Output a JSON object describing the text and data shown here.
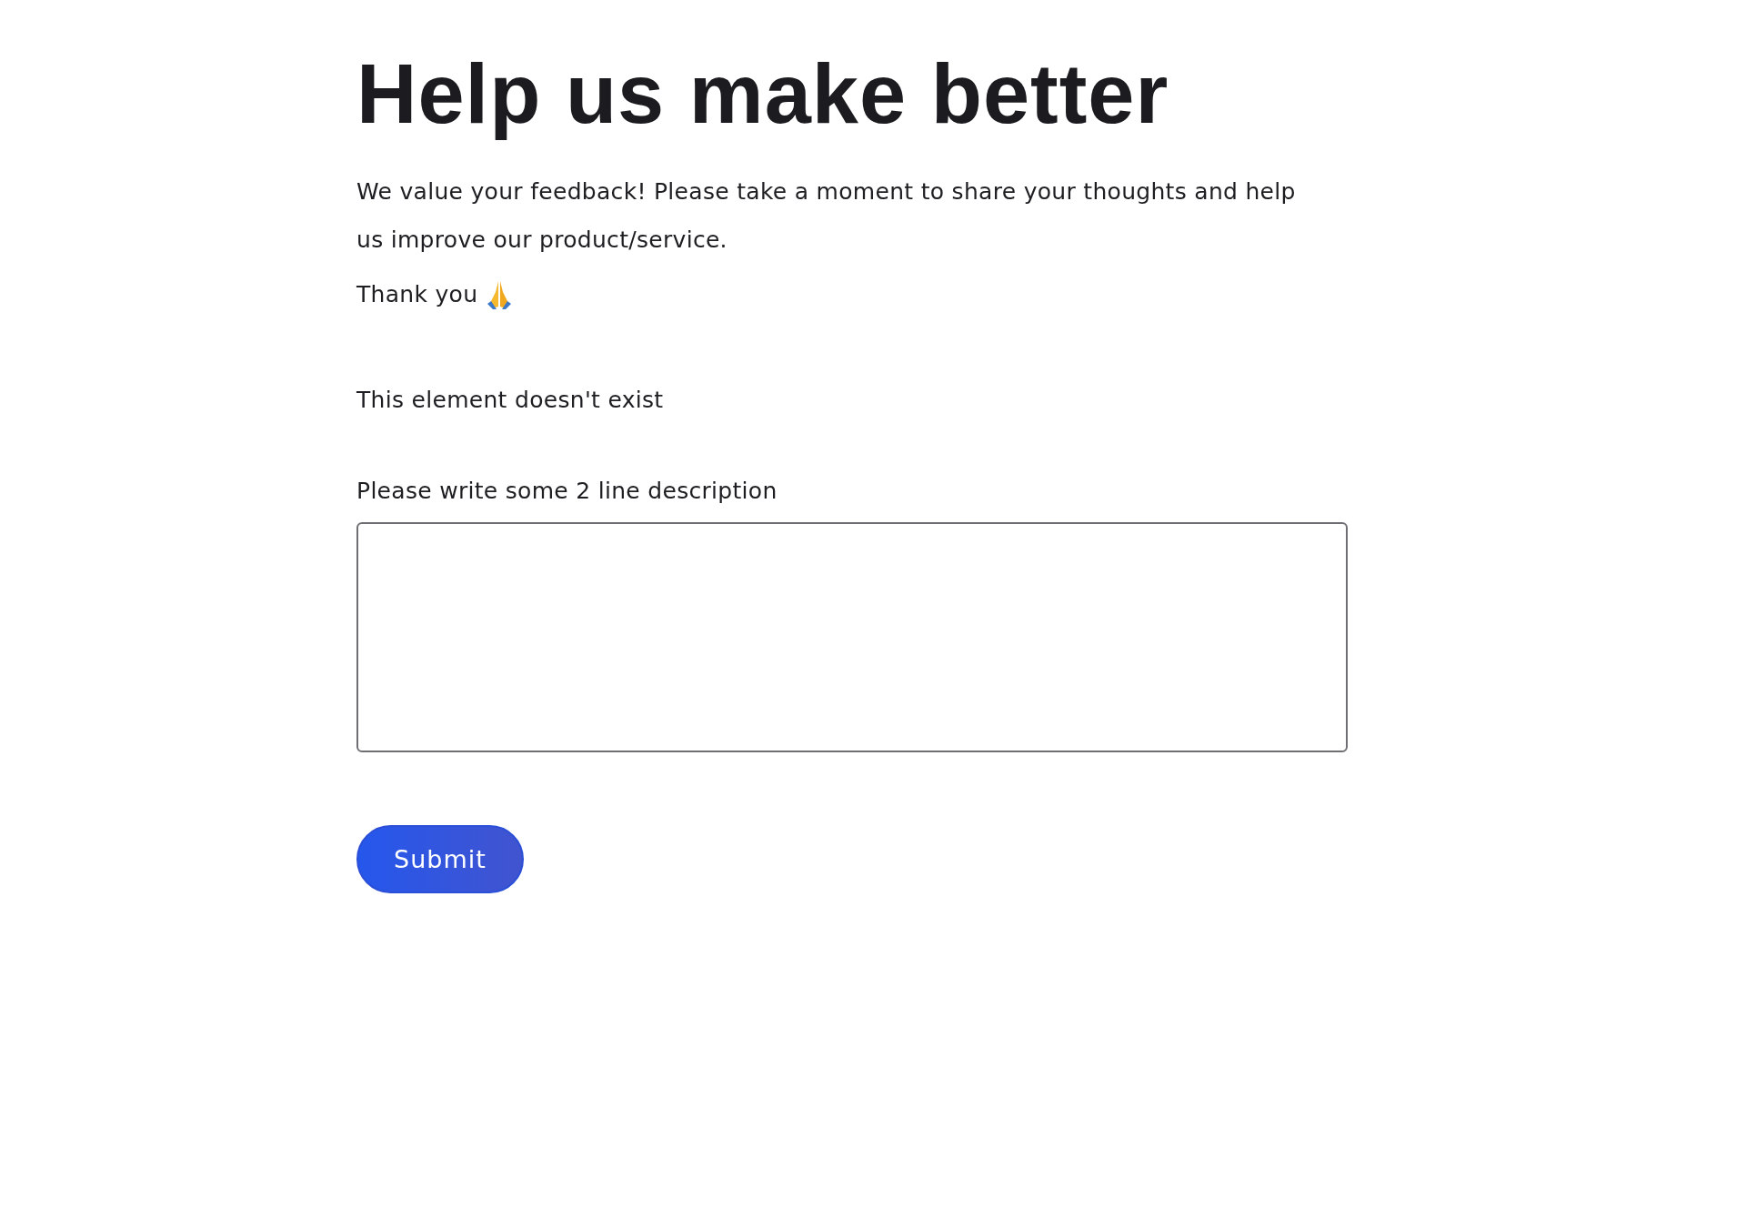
{
  "title": "Help us make better",
  "intro": "We value your feedback! Please take a moment to share your thoughts and help us improve our product/service.",
  "thanks": "Thank you",
  "notice": "This element doesn't exist",
  "field": {
    "label": "Please write some 2 line description"
  },
  "buttons": [
    "Submit"
  ]
}
